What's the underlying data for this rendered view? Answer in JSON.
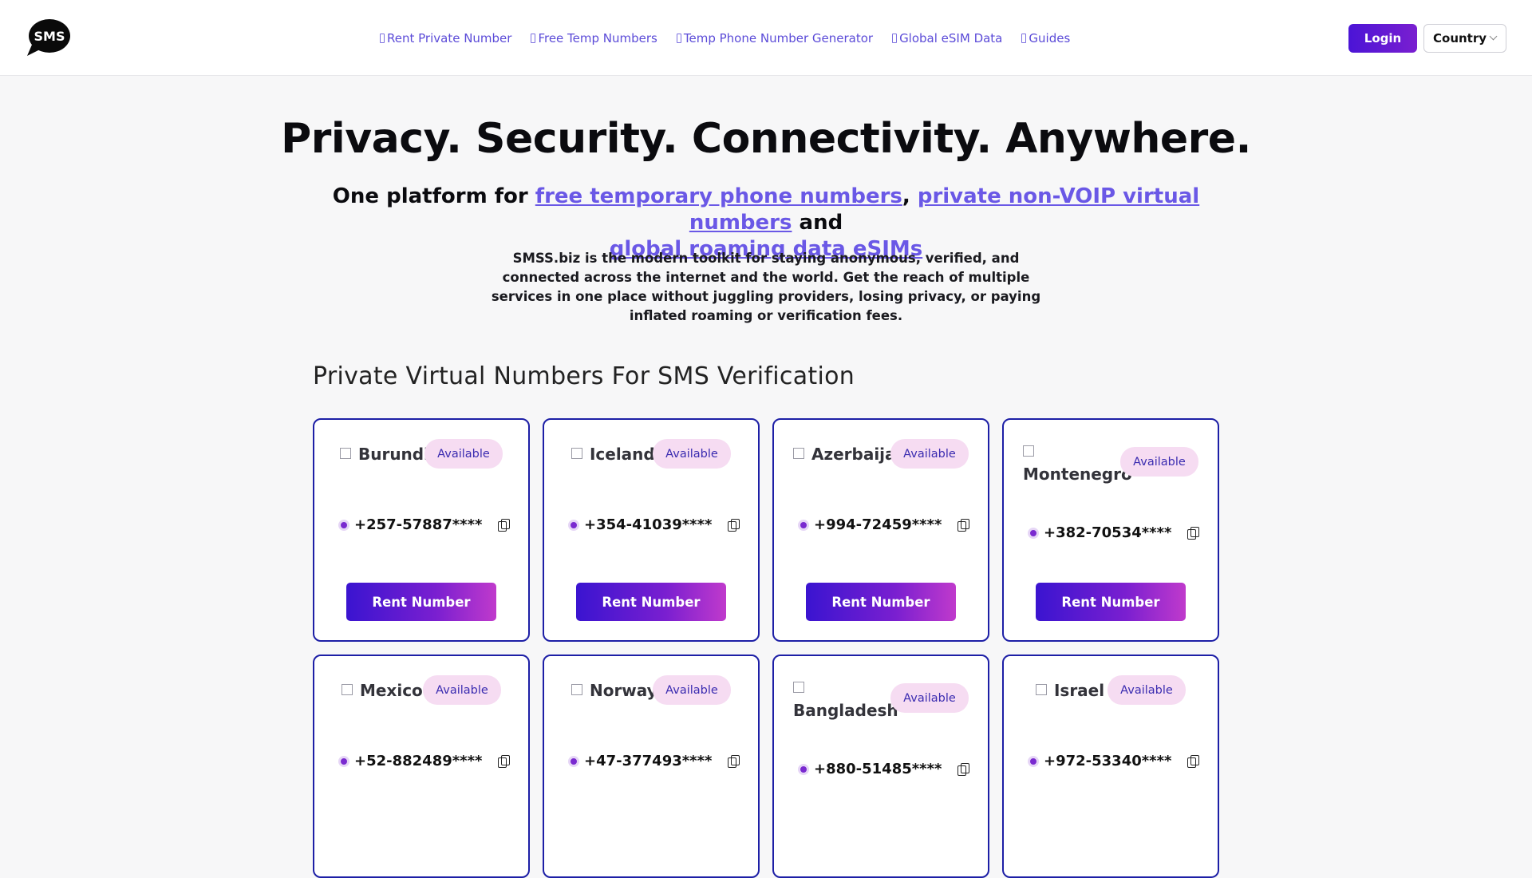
{
  "header": {
    "logo_text": "SMS",
    "nav": [
      {
        "label": "Rent Private Number"
      },
      {
        "label": "Free Temp Numbers"
      },
      {
        "label": "Temp Phone Number Generator"
      },
      {
        "label": "Global eSIM Data"
      },
      {
        "label": "Guides"
      }
    ],
    "login_label": "Login",
    "country_label": "Country"
  },
  "hero": {
    "title": "Privacy. Security. Connectivity. Anywhere.",
    "sub_prefix": "One platform for ",
    "link1": "free temporary phone numbers",
    "sep1": ", ",
    "link2": "private non-VOIP virtual numbers",
    "sep2": " and ",
    "link3": "global roaming data eSIMs",
    "desc": "SMSS.biz is the modern toolkit for staying anonymous, verified, and connected across the internet and the world. Get the reach of multiple services in one place without juggling providers, losing privacy, or paying inflated roaming or verification fees."
  },
  "section": {
    "title": "Private Virtual Numbers For SMS Verification",
    "status_label": "Available",
    "button_label": "Rent Number"
  },
  "cards": [
    {
      "country": "Burundi",
      "phone": "+257-57887****"
    },
    {
      "country": "Iceland",
      "phone": "+354-41039****"
    },
    {
      "country": "Azerbaijan",
      "phone": "+994-72459****"
    },
    {
      "country": "Montenegro",
      "phone": "+382-70534****"
    },
    {
      "country": "Mexico",
      "phone": "+52-882489****"
    },
    {
      "country": "Norway",
      "phone": "+47-377493****"
    },
    {
      "country": "Bangladesh",
      "phone": "+880-51485****"
    },
    {
      "country": "Israel",
      "phone": "+972-53340****"
    }
  ],
  "colors": {
    "accent": "#5b4bd8",
    "card_border": "#1d1fa6",
    "badge_bg": "#f6dcf2"
  }
}
